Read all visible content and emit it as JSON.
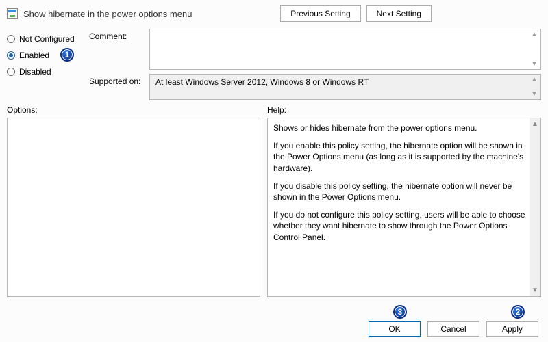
{
  "header": {
    "title": "Show hibernate in the power options menu",
    "prev_label": "Previous Setting",
    "next_label": "Next Setting"
  },
  "state": {
    "not_configured_label": "Not Configured",
    "enabled_label": "Enabled",
    "disabled_label": "Disabled",
    "selected": "Enabled"
  },
  "meta": {
    "comment_label": "Comment:",
    "comment_value": "",
    "supported_label": "Supported on:",
    "supported_value": "At least Windows Server 2012, Windows 8 or Windows RT"
  },
  "labels": {
    "options": "Options:",
    "help": "Help:"
  },
  "help": {
    "p1": "Shows or hides hibernate from the power options menu.",
    "p2": "If you enable this policy setting, the hibernate option will be shown in the Power Options menu (as long as it is supported by the machine's hardware).",
    "p3": "If you disable this policy setting, the hibernate option will never be shown in the Power Options menu.",
    "p4": "If you do not configure this policy setting, users will be able to choose whether they want hibernate to show through the Power Options Control Panel."
  },
  "footer": {
    "ok_label": "OK",
    "cancel_label": "Cancel",
    "apply_label": "Apply"
  },
  "annotations": {
    "b1": "1",
    "b2": "2",
    "b3": "3"
  }
}
